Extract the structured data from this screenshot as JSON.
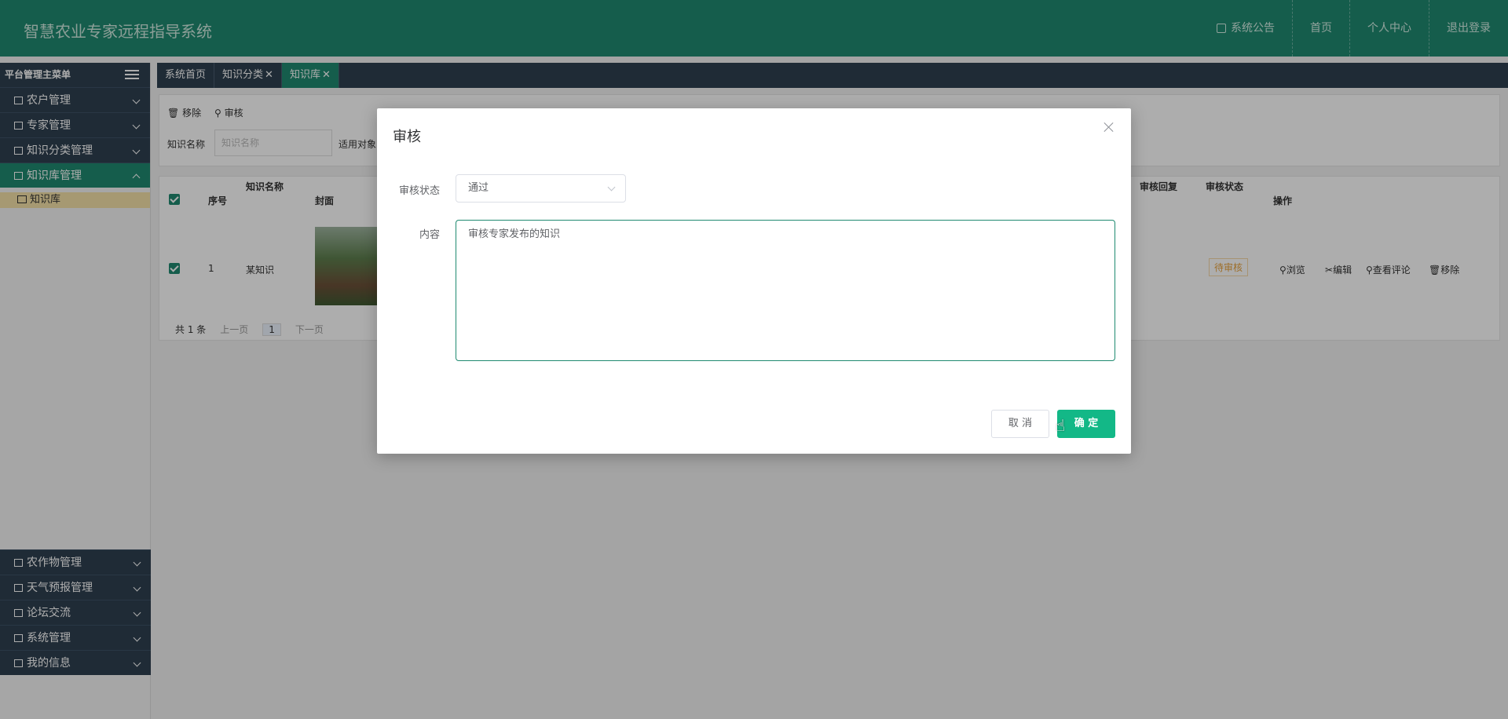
{
  "header": {
    "title": "智慧农业专家远程指导系统",
    "nav": [
      "系统公告",
      "首页",
      "个人中心",
      "退出登录"
    ]
  },
  "sidebar": {
    "heading": "平台管理主菜单",
    "items": [
      "农户管理",
      "专家管理",
      "知识分类管理",
      "知识库管理"
    ],
    "subitem": "知识库",
    "bottom_items": [
      "农作物管理",
      "天气预报管理",
      "论坛交流",
      "系统管理",
      "我的信息"
    ]
  },
  "tabs": [
    "系统首页",
    "知识分类",
    "知识库"
  ],
  "toolbar": {
    "remove": "移除",
    "audit": "审核"
  },
  "filters": {
    "name_label": "知识名称",
    "name_placeholder": "知识名称",
    "target_label": "适用对象"
  },
  "table": {
    "headers": [
      "序号",
      "知识名称",
      "封面",
      "审核回复",
      "审核状态",
      "操作"
    ],
    "row": {
      "index": "1",
      "name": "某知识",
      "status": "待审核"
    },
    "ops": [
      "浏览",
      "编辑",
      "查看评论",
      "移除"
    ]
  },
  "pager": {
    "total": "共 1 条",
    "prev": "上一页",
    "page": "1",
    "next": "下一页"
  },
  "modal": {
    "title": "审核",
    "status_label": "审核状态",
    "status_value": "通过",
    "content_label": "内容",
    "content_value": "审核专家发布的知识",
    "cancel": "取 消",
    "confirm": "确 定"
  },
  "colors": {
    "primary": "#1f8a70",
    "sidebar": "#2f4050",
    "confirm": "#13b887",
    "highlight": "#f5e2a8",
    "status_pending": "#e8a23c"
  }
}
